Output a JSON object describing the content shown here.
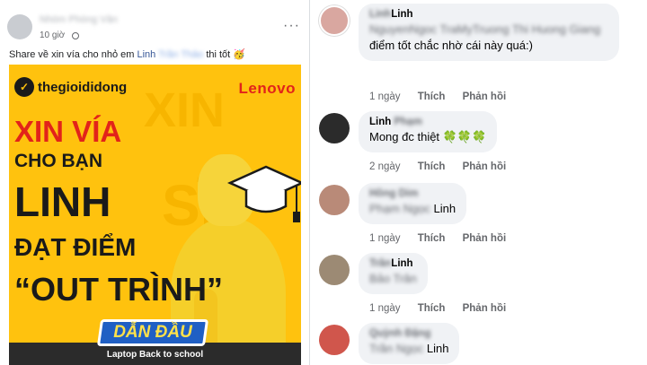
{
  "post": {
    "author": "Nhóm Phòng Vân",
    "time": "10 giờ",
    "text_prefix": "Share về xin vía cho nhỏ em ",
    "mention_name": "Linh",
    "mention_hidden": "Trần Thảo",
    "text_suffix": " thi tốt 🥳",
    "more_label": "···"
  },
  "banner": {
    "brand": "thegioididong",
    "brand_mark": "✓",
    "partner": "Lenovo",
    "line1": "XIN VÍA",
    "line2": "CHO BẠN",
    "line3": "LINH",
    "line4": "ĐẠT ĐIỂM",
    "line5": "“OUT TRÌNH”",
    "badge": "DẪN ĐẦU",
    "tagline": "Laptop Back to school",
    "colors": {
      "background": "#ffc20e",
      "accent": "#e2231a",
      "badge": "#1f5fc4"
    }
  },
  "comments": [
    {
      "name_hidden": "Linh",
      "name": "Linh",
      "mentions_hidden": "NguyenNgoc TraMyTruong Thi Huong Giang",
      "text": "điểm tốt chắc nhờ cái này quá:)",
      "time": "1 ngày",
      "like": "Thích",
      "reply": "Phản hồi"
    },
    {
      "name": "Linh",
      "name_hidden": "Phạm",
      "text": "Mong đc thiệt 🍀🍀🍀",
      "time": "2 ngày",
      "like": "Thích",
      "reply": "Phản hồi"
    },
    {
      "name_hidden": "Hồng Dim",
      "mention_hidden": "Phạm Ngọc",
      "mention": "Linh",
      "time": "1 ngày",
      "like": "Thích",
      "reply": "Phản hồi"
    },
    {
      "name_hidden": "Trần",
      "name": "Linh",
      "mention_hidden": "Bảo Trân",
      "time": "1 ngày",
      "like": "Thích",
      "reply": "Phản hồi"
    },
    {
      "name_hidden": "Quỳnh Đặng",
      "mention_hidden": "Trần Ngọc",
      "mention": "Linh"
    }
  ]
}
